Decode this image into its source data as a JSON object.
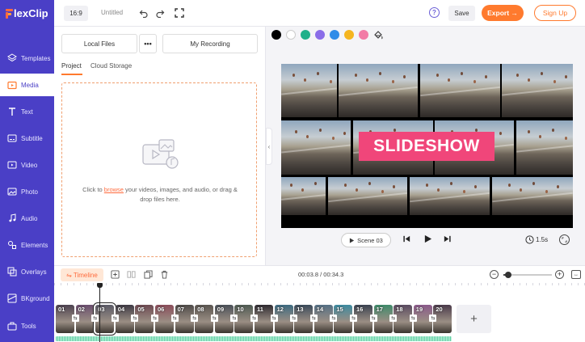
{
  "app": {
    "logo_text": "lexClip",
    "brand_color": "#4a3fc6",
    "accent_color": "#ff7a2e"
  },
  "sidebar": {
    "items": [
      {
        "label": "Templates",
        "icon": "layers-icon"
      },
      {
        "label": "Media",
        "icon": "media-folder-icon",
        "active": true
      },
      {
        "label": "Text",
        "icon": "text-icon"
      },
      {
        "label": "Subtitle",
        "icon": "subtitle-icon"
      },
      {
        "label": "Video",
        "icon": "video-icon"
      },
      {
        "label": "Photo",
        "icon": "photo-icon"
      },
      {
        "label": "Audio",
        "icon": "music-note-icon"
      },
      {
        "label": "Elements",
        "icon": "elements-icon"
      },
      {
        "label": "Overlays",
        "icon": "overlay-icon"
      },
      {
        "label": "BKground",
        "icon": "background-icon"
      },
      {
        "label": "Tools",
        "icon": "toolbox-icon"
      }
    ]
  },
  "topbar": {
    "ratio": "16:9",
    "project_title": "Untitled",
    "help": "?",
    "save_label": "Save",
    "export_label": "Export →",
    "signup_label": "Sign Up"
  },
  "media_panel": {
    "local_files_label": "Local Files",
    "more_label": "•••",
    "recording_label": "My Recording",
    "tabs": [
      "Project",
      "Cloud Storage"
    ],
    "drop_text_before": "Click to ",
    "drop_link": "browse",
    "drop_text_after": " your videos, images, and audio, or drag & drop files here."
  },
  "canvas": {
    "swatches": [
      "#000000",
      "#ffffff",
      "#1fb08a",
      "#8a6de8",
      "#2f8ce8",
      "#f5b51f",
      "#f27ba6"
    ],
    "title_text": "SLIDESHOW",
    "scene_label": "Scene 03",
    "duration": "1.5s"
  },
  "timeline": {
    "tab_label": "Timeline",
    "time_readout": "00:03.8 / 00:34.3",
    "zoom_fraction": 0.1,
    "clips": [
      "01",
      "02",
      "03",
      "04",
      "05",
      "06",
      "07",
      "08",
      "09",
      "10",
      "11",
      "12",
      "13",
      "14",
      "15",
      "16",
      "17",
      "18",
      "19",
      "20"
    ],
    "selected_clip": "03",
    "add_label": "+"
  }
}
